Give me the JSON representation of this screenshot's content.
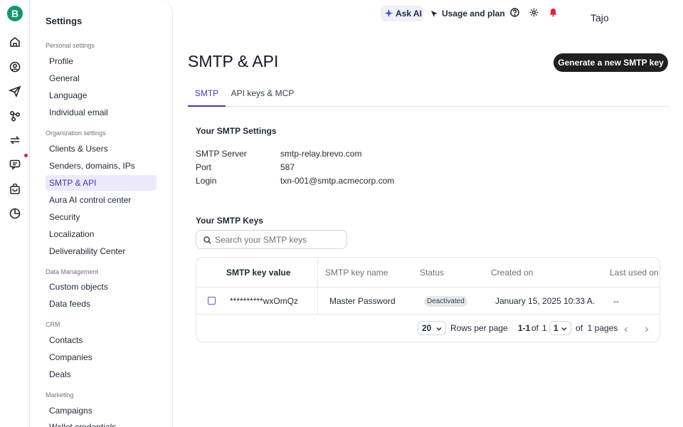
{
  "rail": {
    "logo_letter": "B",
    "icons": [
      "home-icon",
      "contacts-icon",
      "send-icon",
      "automation-icon",
      "sync-icon",
      "chat-icon",
      "shop-icon",
      "meetings-icon"
    ]
  },
  "sidebar": {
    "title": "Settings",
    "sections": [
      {
        "label": "Personal settings",
        "items": [
          "Profile",
          "General",
          "Language",
          "Individual email"
        ]
      },
      {
        "label": "Organization settings",
        "items": [
          "Clients & Users",
          "Senders, domains, IPs",
          "SMTP & API",
          "Aura AI control center",
          "Security",
          "Localization",
          "Deliverability Center"
        ]
      },
      {
        "label": "Data Management",
        "items": [
          "Custom objects",
          "Data feeds"
        ]
      },
      {
        "label": "CRM",
        "items": [
          "Contacts",
          "Companies",
          "Deals"
        ]
      },
      {
        "label": "Marketing",
        "items": [
          "Campaigns",
          "Wallet credentials"
        ]
      }
    ],
    "active_item": "SMTP & API"
  },
  "header": {
    "ask_ai": "Ask AI",
    "usage": "Usage and plan",
    "user": "Tajo"
  },
  "page": {
    "title": "SMTP & API",
    "generate_button": "Generate a new SMTP key",
    "tabs": [
      "SMTP",
      "API keys & MCP"
    ],
    "active_tab": "SMTP"
  },
  "smtp_settings": {
    "heading": "Your SMTP Settings",
    "rows": [
      {
        "key": "SMTP Server",
        "value": "smtp-relay.brevo.com"
      },
      {
        "key": "Port",
        "value": "587"
      },
      {
        "key": "Login",
        "value": "txn-001@smtp.acmecorp.com"
      }
    ]
  },
  "smtp_keys": {
    "heading": "Your SMTP Keys",
    "search_placeholder": "Search your SMTP keys",
    "columns": [
      "SMTP key value",
      "SMTP key name",
      "Status",
      "Created on",
      "Last used on"
    ],
    "rows": [
      {
        "value": "**********wxOmQz",
        "name": "Master Password",
        "status": "Deactivated",
        "created": "January 15, 2025 10:33 A...",
        "last_used": "--"
      }
    ],
    "pagination": {
      "rows_per_page_value": "20",
      "rows_per_page_label": "Rows per page",
      "range": "1-1",
      "of_label": "of",
      "total": "1",
      "page_value": "1",
      "of_pages_label": "of  1 pages"
    }
  },
  "colors": {
    "brand": "#0b996e",
    "accent": "#3f3ab4",
    "primary_button": "#1f2021",
    "notification": "#e11d48"
  }
}
